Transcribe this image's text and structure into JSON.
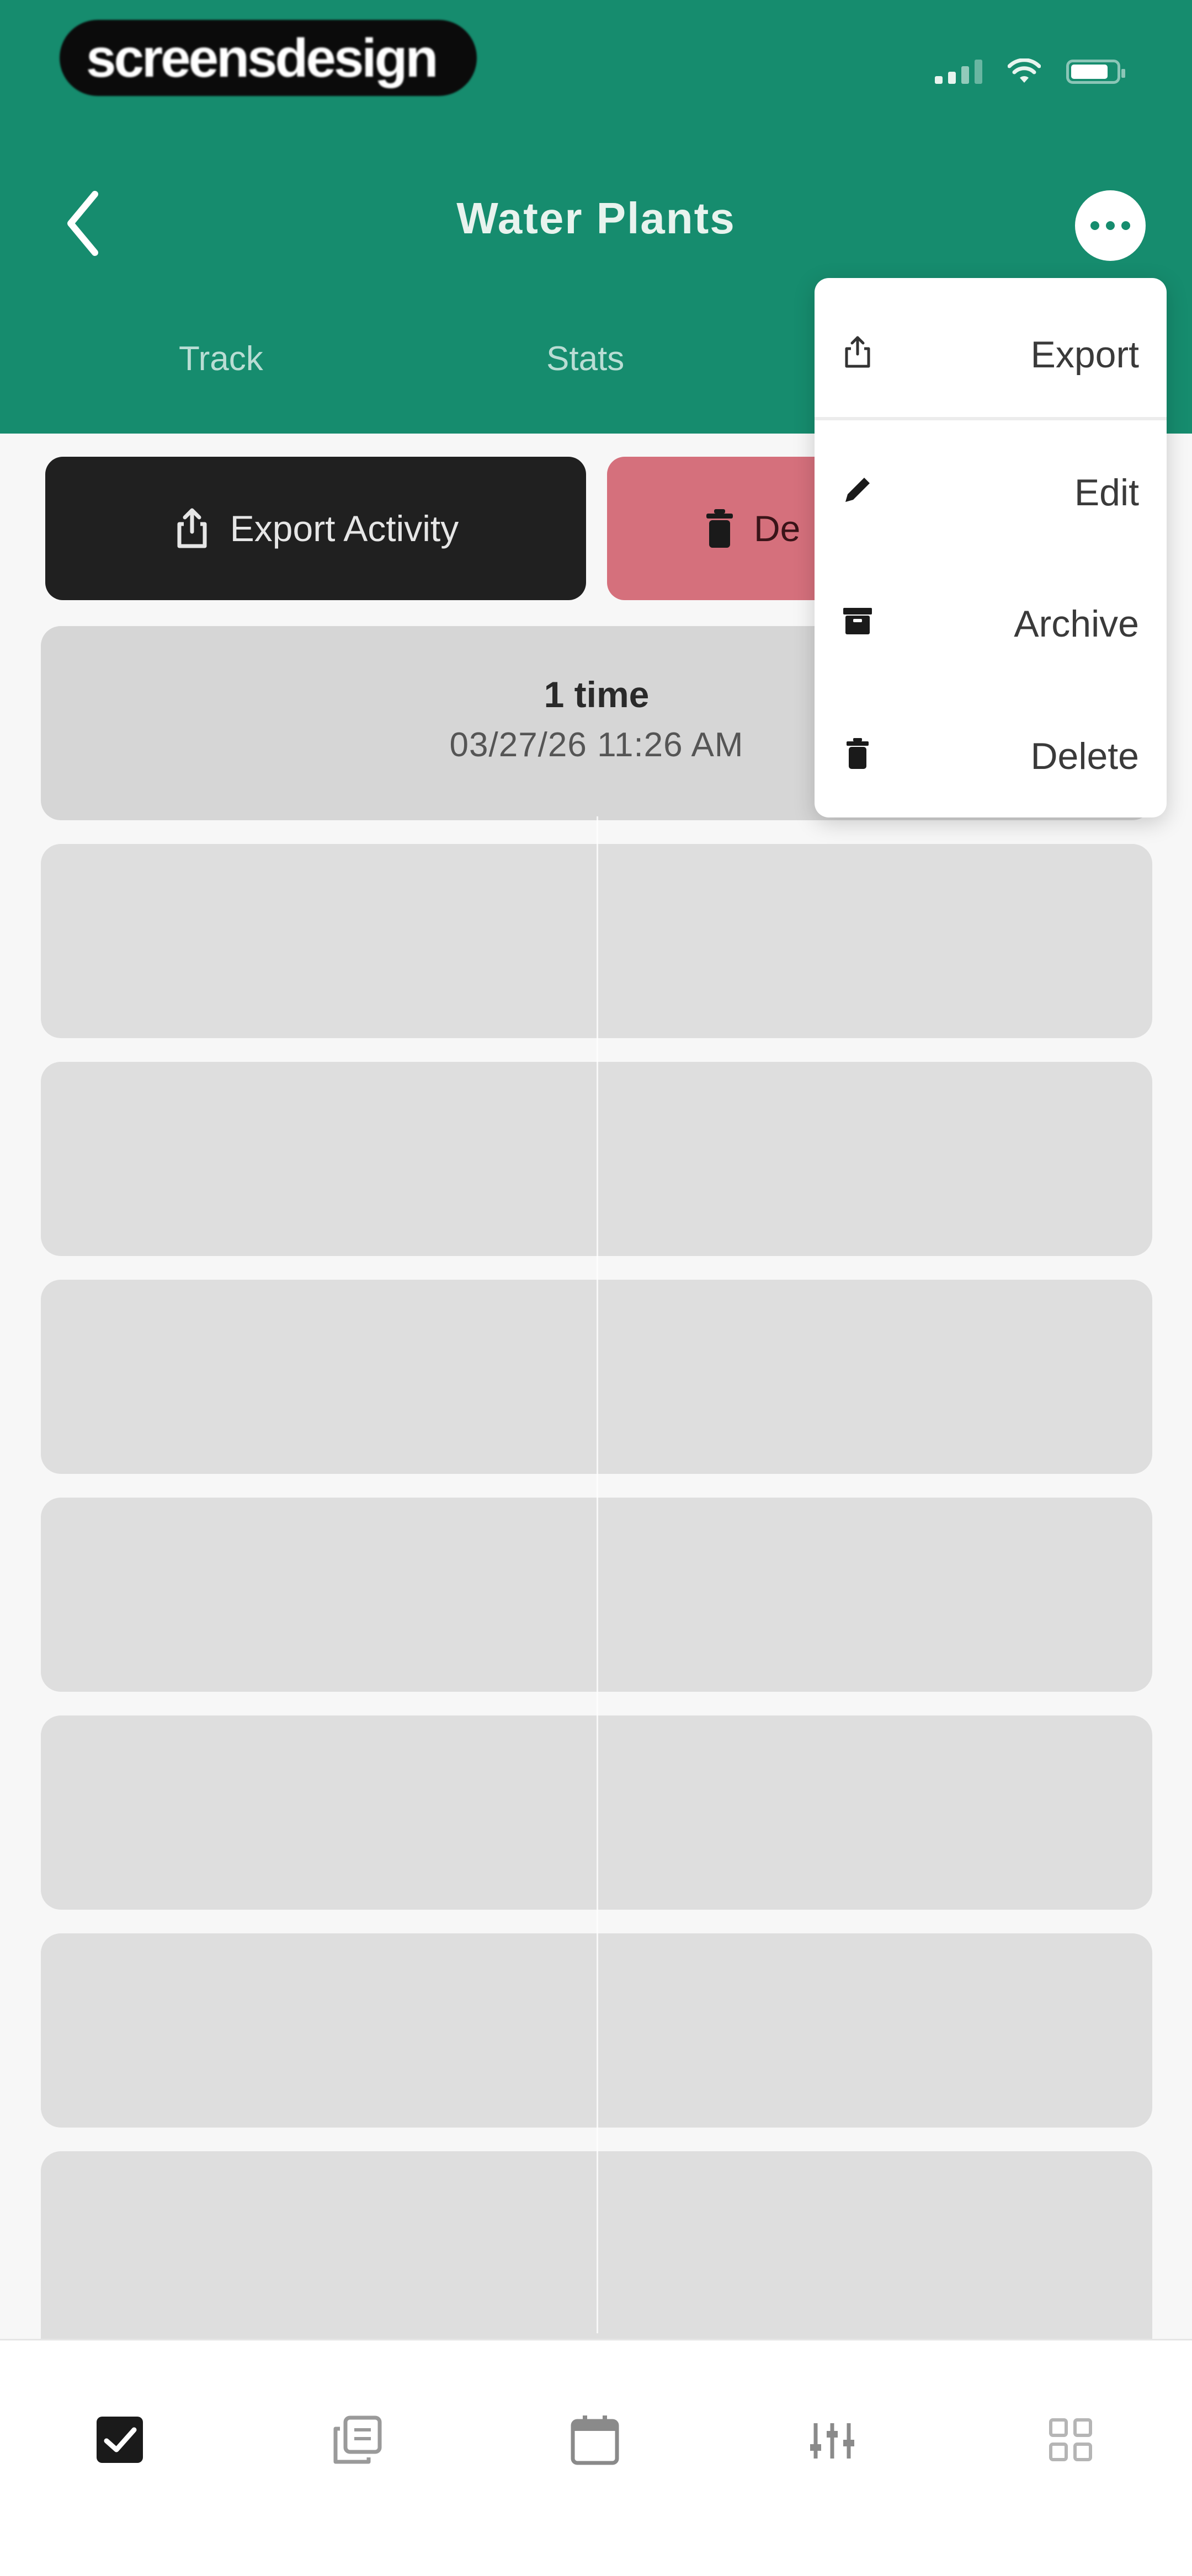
{
  "status_bar": {
    "carrier_badge": "screensdesign",
    "icons": [
      "signal-icon",
      "wifi-icon",
      "battery-icon"
    ]
  },
  "header": {
    "title": "Water Plants",
    "back_icon": "chevron-left-icon",
    "more_icon": "ellipsis-icon",
    "tabs": [
      {
        "label": "Track"
      },
      {
        "label": "Stats"
      }
    ]
  },
  "actions": {
    "export_label": "Export Activity",
    "export_icon": "share-icon",
    "delete_label": "De",
    "delete_icon": "trash-icon"
  },
  "entries": [
    {
      "count": "1 time",
      "timestamp": "03/27/26 11:26 AM"
    }
  ],
  "menu": {
    "items": [
      {
        "label": "Export",
        "icon": "share-icon"
      },
      {
        "label": "Edit",
        "icon": "pencil-icon"
      },
      {
        "label": "Archive",
        "icon": "archive-icon"
      },
      {
        "label": "Delete",
        "icon": "trash-icon"
      }
    ]
  },
  "tabbar": {
    "items": [
      {
        "icon": "checkbox-icon",
        "active": true
      },
      {
        "icon": "copy-icon",
        "active": false
      },
      {
        "icon": "calendar-icon",
        "active": false
      },
      {
        "icon": "sliders-icon",
        "active": false
      },
      {
        "icon": "grid-icon",
        "active": false
      }
    ]
  },
  "colors": {
    "header": "#168c6e",
    "export_button": "#202020",
    "delete_button": "#d5707c",
    "card": "#dedede",
    "background": "#f7f7f7"
  }
}
